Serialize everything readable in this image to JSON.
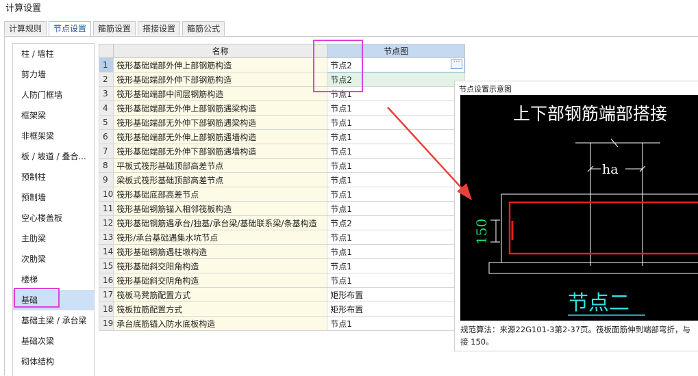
{
  "window": {
    "title": "计算设置"
  },
  "tabs": [
    {
      "label": "计算规则"
    },
    {
      "label": "节点设置"
    },
    {
      "label": "箍筋设置"
    },
    {
      "label": "搭接设置"
    },
    {
      "label": "箍筋公式"
    }
  ],
  "categories": [
    "柱 / 墙柱",
    "剪力墙",
    "人防门框墙",
    "框架梁",
    "非框架梁",
    "板 / 坡道 / 叠合...",
    "预制柱",
    "预制墙",
    "空心楼盖板",
    "主肋梁",
    "次肋梁",
    "楼梯",
    "基础",
    "基础主梁 / 承台梁",
    "基础次梁",
    "砌体结构"
  ],
  "grid": {
    "col_name": "名称",
    "col_node": "节点图",
    "rows": [
      {
        "num": "1",
        "name": "筏形基础端部外伸上部钢筋构造",
        "node": "节点2"
      },
      {
        "num": "2",
        "name": "筏形基础端部外伸下部钢筋构造",
        "node": "节点2"
      },
      {
        "num": "3",
        "name": "筏形基础端部中间层钢筋构造",
        "node": "节点1"
      },
      {
        "num": "4",
        "name": "筏形基础端部无外伸上部钢筋遇梁构造",
        "node": "节点1"
      },
      {
        "num": "5",
        "name": "筏形基础端部无外伸下部钢筋遇梁构造",
        "node": "节点1"
      },
      {
        "num": "6",
        "name": "筏形基础端部无外伸上部钢筋遇墙构造",
        "node": "节点1"
      },
      {
        "num": "7",
        "name": "筏形基础端部无外伸下部钢筋遇墙构造",
        "node": "节点1"
      },
      {
        "num": "8",
        "name": "平板式筏形基础顶部高差节点",
        "node": "节点1"
      },
      {
        "num": "9",
        "name": "梁板式筏形基础顶部高差节点",
        "node": "节点1"
      },
      {
        "num": "10",
        "name": "筏形基础底部高差节点",
        "node": "节点1"
      },
      {
        "num": "11",
        "name": "筏形基础钢筋锚入相邻筏板构造",
        "node": "节点1"
      },
      {
        "num": "12",
        "name": "筏形基础钢筋遇承台/独基/承台梁/基础联系梁/条基构造",
        "node": "节点2"
      },
      {
        "num": "13",
        "name": "筏形/承台基础遇集水坑节点",
        "node": "节点1"
      },
      {
        "num": "14",
        "name": "筏形基础钢筋遇柱墩构造",
        "node": "节点1"
      },
      {
        "num": "15",
        "name": "筏形基础斜交阳角构造",
        "node": "节点1"
      },
      {
        "num": "16",
        "name": "筏形基础斜交阴角构造",
        "node": "节点1"
      },
      {
        "num": "17",
        "name": "筏板马凳筋配置方式",
        "node": "矩形布置"
      },
      {
        "num": "18",
        "name": "筏板拉筋配置方式",
        "node": "矩形布置"
      },
      {
        "num": "19",
        "name": "承台底筋锚入防水底板构造",
        "node": "节点1"
      }
    ],
    "ellipsis": "···"
  },
  "preview": {
    "title": "节点设置示意图",
    "drawing_title": "上下部钢筋端部搭接",
    "dim_ha": "ha",
    "dim_150": "150",
    "node_label": "节点二",
    "desc_line1": "规范算法：来源22G101-3第2-37页。筏板面筋伸到端部弯折，与",
    "desc_line2": "接 150。"
  },
  "colors": {
    "highlight": "#e040e0",
    "arrow": "#e8403a",
    "drawing_bg": "#000000",
    "drawing_red": "#e02020",
    "drawing_green": "#19e07a",
    "drawing_cyan": "#2fe0e0"
  }
}
